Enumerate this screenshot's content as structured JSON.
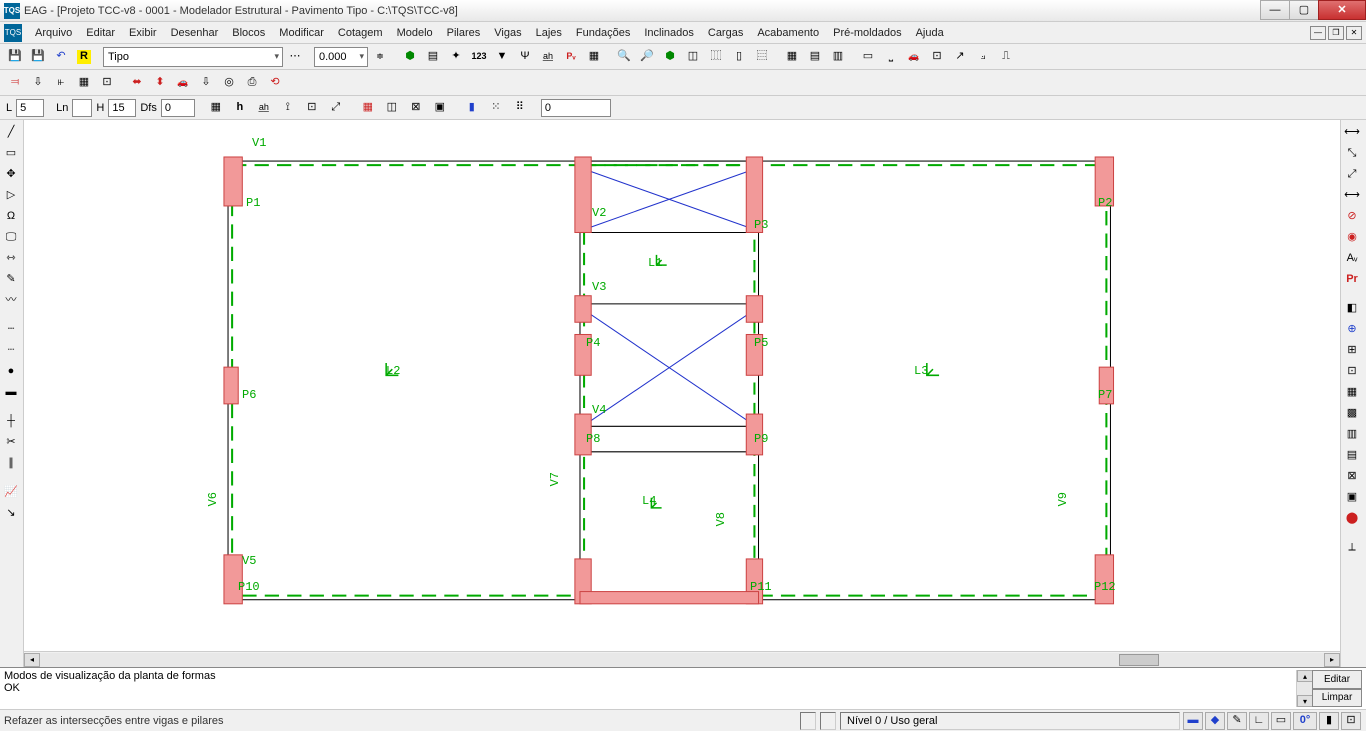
{
  "titlebar": {
    "icon_text": "TQS",
    "text": "EAG - [Projeto TCC-v8 - 0001 - Modelador Estrutural - Pavimento Tipo - C:\\TQS\\TCC-v8]"
  },
  "menubar": {
    "icon_text": "TQS",
    "items": [
      "Arquivo",
      "Editar",
      "Exibir",
      "Desenhar",
      "Blocos",
      "Modificar",
      "Cotagem",
      "Modelo",
      "Pilares",
      "Vigas",
      "Lajes",
      "Fundações",
      "Inclinados",
      "Cargas",
      "Acabamento",
      "Pré-moldados",
      "Ajuda"
    ]
  },
  "toolbar1": {
    "combo_layer": "Tipo",
    "combo_scale": "0.000",
    "icons": [
      "💾",
      "💾",
      "↶",
      "R"
    ]
  },
  "fields": {
    "L": "5",
    "Ln": "",
    "H": "15",
    "Dfs": "0",
    "last": "0"
  },
  "drawing": {
    "beams": [
      "V1",
      "V2",
      "V3",
      "V4",
      "V5",
      "V6",
      "V7",
      "V8",
      "V9"
    ],
    "pillars": [
      "P1",
      "P2",
      "P3",
      "P4",
      "P5",
      "P6",
      "P7",
      "P8",
      "P9",
      "P10",
      "P11",
      "P12"
    ],
    "slabs": [
      "L1",
      "L2",
      "L3",
      "L4"
    ]
  },
  "console": {
    "line1": "Modos de visualização da planta de formas",
    "line2": "OK",
    "edit_btn": "Editar",
    "clear_btn": "Limpar"
  },
  "statusbar": {
    "hint": "Refazer as intersecções entre vigas e pilares",
    "level": "Nível 0 / Uso geral",
    "angle": "0°"
  }
}
